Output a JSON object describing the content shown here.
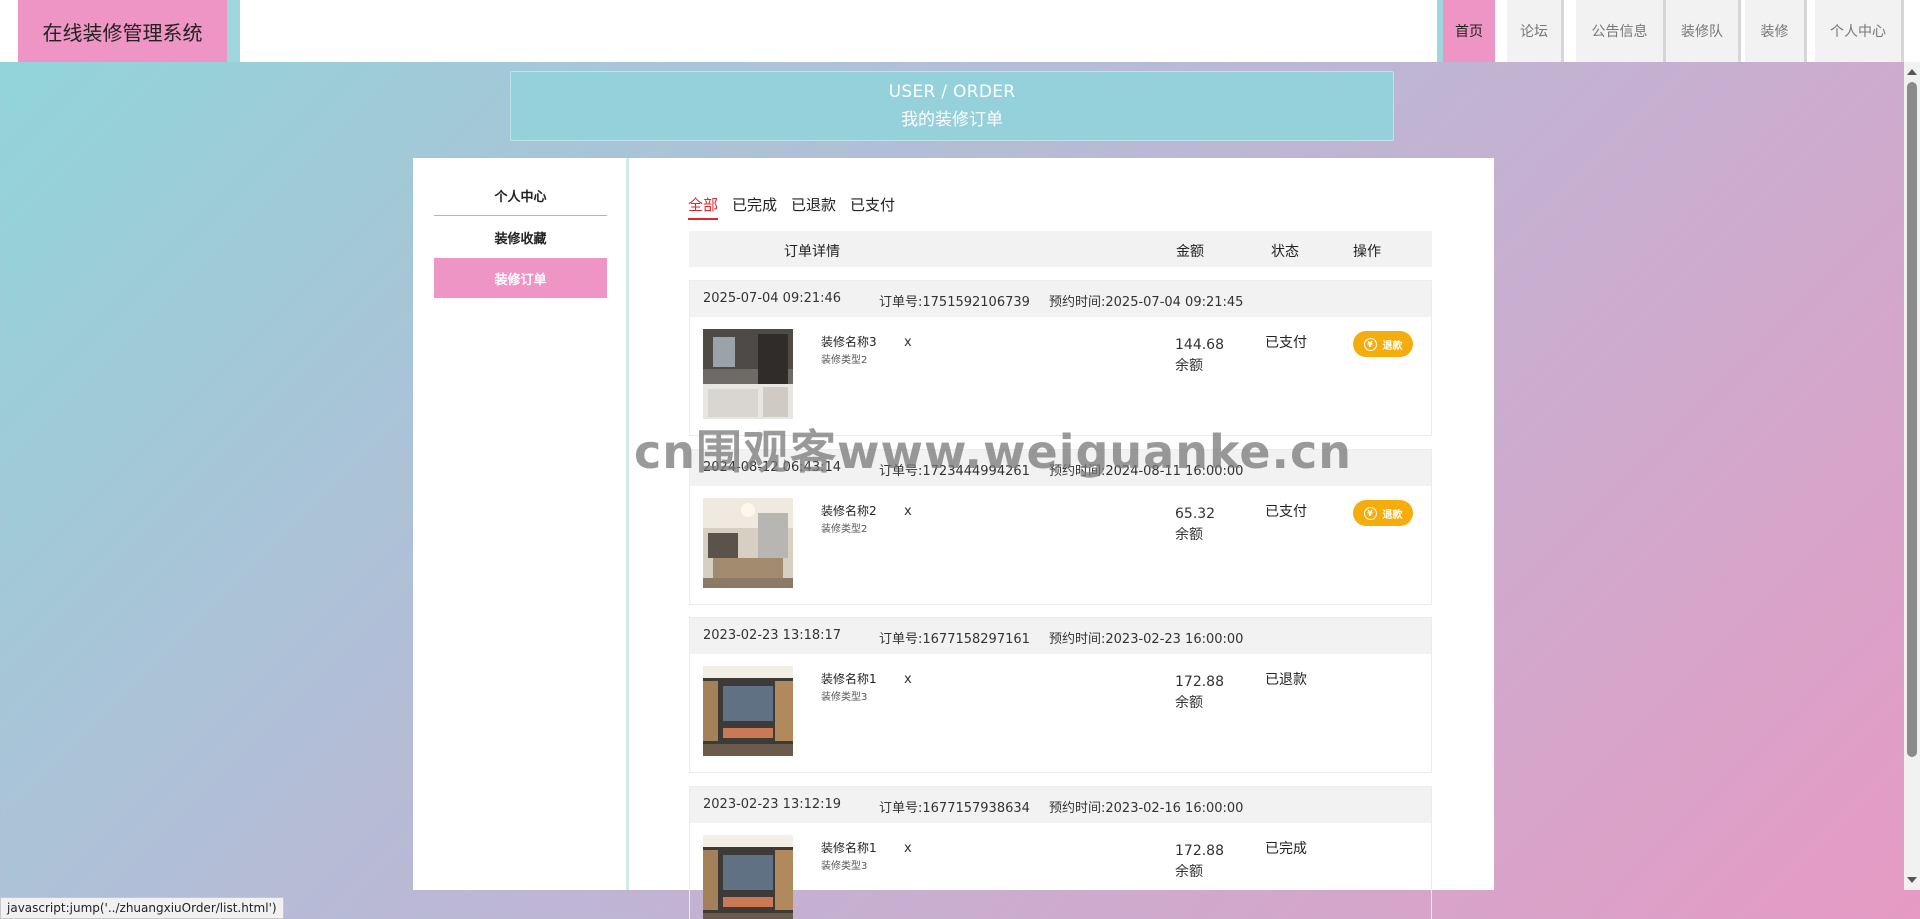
{
  "app": {
    "title": "在线装修管理系统"
  },
  "nav": {
    "items": [
      {
        "label": "首页"
      },
      {
        "label": "论坛"
      },
      {
        "label": "公告信息"
      },
      {
        "label": "装修队"
      },
      {
        "label": "装修"
      },
      {
        "label": "个人中心"
      }
    ]
  },
  "banner": {
    "en": "USER / ORDER",
    "cn": "我的装修订单"
  },
  "sidebar": {
    "items": [
      {
        "label": "个人中心"
      },
      {
        "label": "装修收藏"
      },
      {
        "label": "装修订单"
      }
    ]
  },
  "tabs": [
    {
      "label": "全部"
    },
    {
      "label": "已完成"
    },
    {
      "label": "已退款"
    },
    {
      "label": "已支付"
    }
  ],
  "table_header": {
    "detail": "订单详情",
    "amount": "金额",
    "status": "状态",
    "action": "操作"
  },
  "orders": [
    {
      "time": "2025-07-04 09:21:46",
      "order_no": "订单号:1751592106739",
      "booking": "预约时间:2025-07-04 09:21:45",
      "name": "装修名称3",
      "type": "装修类型2",
      "qty": "x",
      "price": "144.68",
      "pay": "余额",
      "status": "已支付",
      "refund": "退款"
    },
    {
      "time": "2024-08-12 06:43:14",
      "order_no": "订单号:1723444994261",
      "booking": "预约时间:2024-08-11 16:00:00",
      "name": "装修名称2",
      "type": "装修类型2",
      "qty": "x",
      "price": "65.32",
      "pay": "余额",
      "status": "已支付",
      "refund": "退款"
    },
    {
      "time": "2023-02-23 13:18:17",
      "order_no": "订单号:1677158297161",
      "booking": "预约时间:2023-02-23 16:00:00",
      "name": "装修名称1",
      "type": "装修类型3",
      "qty": "x",
      "price": "172.88",
      "pay": "余额",
      "status": "已退款"
    },
    {
      "time": "2023-02-23 13:12:19",
      "order_no": "订单号:1677157938634",
      "booking": "预约时间:2023-02-16 16:00:00",
      "name": "装修名称1",
      "type": "装修类型3",
      "qty": "x",
      "price": "172.88",
      "pay": "余额",
      "status": "已完成"
    }
  ],
  "watermark": "cn围观客www.weiguanke.cn",
  "statusbar": {
    "url": "javascript:jump('../zhuangxiuOrder/list.html')"
  },
  "colors": {
    "accent_pink": "#ee95c5",
    "banner_teal": "#95d1da",
    "active_tab_red": "#e0272c",
    "refund_orange": "#f5ad0d"
  }
}
